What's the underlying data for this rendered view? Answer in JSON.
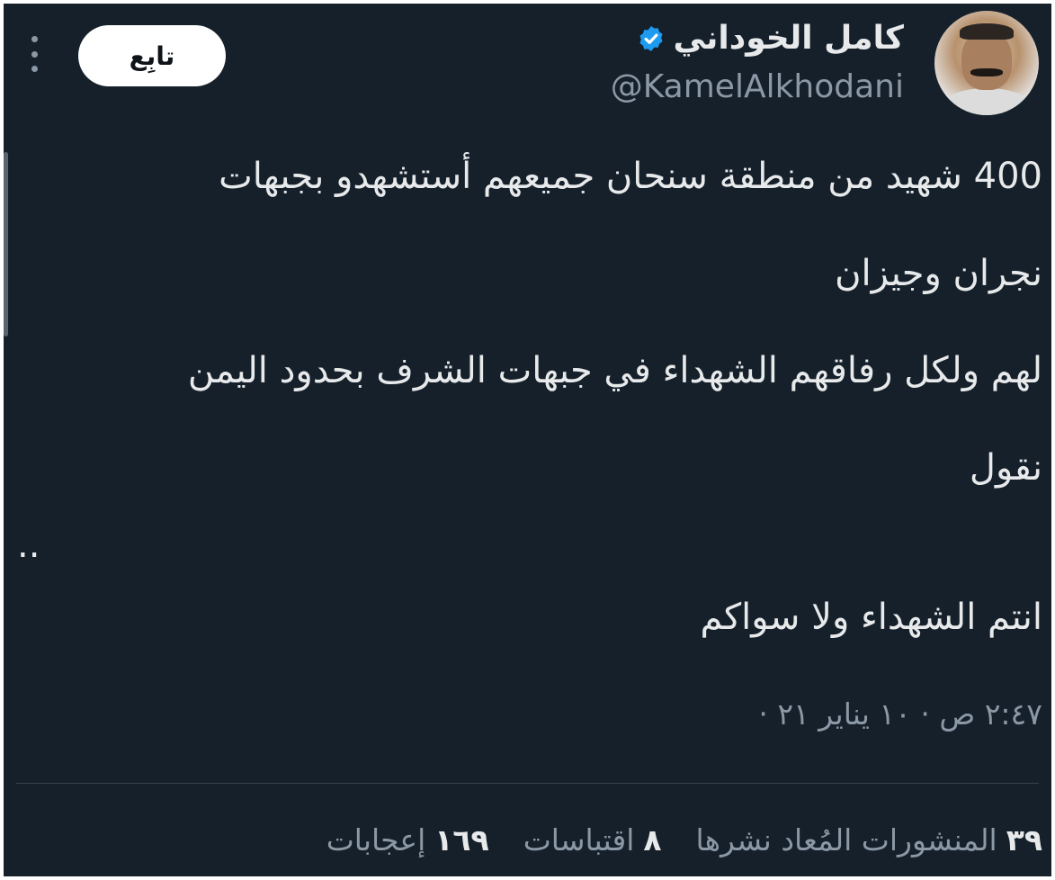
{
  "author": {
    "display_name": "كامل الخوداني",
    "handle": "@KamelAlkhodani",
    "verified_icon": "verified-badge-icon",
    "verified_color": "#1d9bf0"
  },
  "actions": {
    "follow_label": "تابِع",
    "more_icon": "more-vertical-icon"
  },
  "tweet": {
    "lines": [
      "400 شهيد من منطقة سنحان جميعهم أستشهدو بجبهات",
      "نجران وجيزان",
      "لهم ولكل رفاقهم الشهداء في جبهات الشرف بحدود اليمن",
      "نقول",
      "..",
      "انتم الشهداء ولا سواكم"
    ],
    "timestamp": "٢:٤٧ ص · ١٠ يناير ٢١ ·"
  },
  "stats": {
    "retweets_count": "٣٩",
    "retweets_label": "المنشورات المُعاد نشرها",
    "quotes_count": "٨",
    "quotes_label": "اقتباسات",
    "likes_count": "١٦٩",
    "likes_label": "إعجابات"
  },
  "colors": {
    "background": "#15202b",
    "primary_text": "#e7e9ea",
    "secondary_text": "#8b98a5",
    "divider": "#38444d",
    "follow_button_bg": "#ffffff"
  }
}
